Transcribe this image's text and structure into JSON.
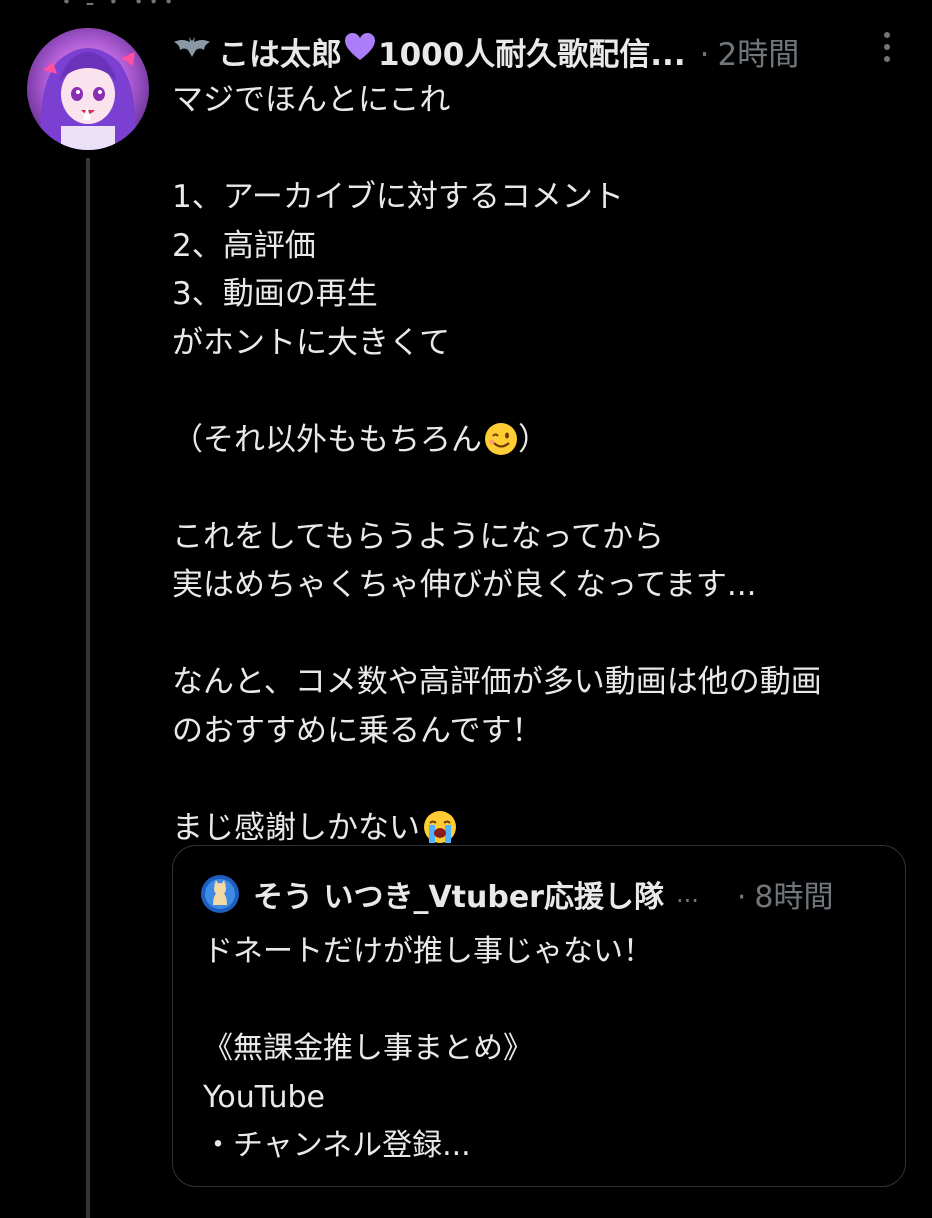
{
  "top_fragment": "･ - ･ ･･･",
  "post": {
    "display_name": "こは太郎",
    "display_name_suffix": "1000人耐久歌配信...",
    "name_emoji_prefix": "bat-emoji",
    "name_emoji_mid": "purple-heart-emoji",
    "separator": "·",
    "time": "2時間",
    "more_icon": "more-vertical-icon",
    "lines": [
      "マジでほんとにこれ",
      "",
      "1、アーカイブに対するコメント",
      "2、高評価",
      "3、動画の再生",
      "がホントに大きくて",
      "",
      "（それ以外ももちろん",
      "",
      "これをしてもらうようになってから",
      "実はめちゃくちゃ伸びが良くなってます...",
      "",
      "なんと、コメ数や高評価が多い動画は他の動画",
      "のおすすめに乗るんです！",
      "",
      "まじ感謝しかない"
    ],
    "wink_line_tail": "）",
    "wink_emoji": "winking-face-emoji",
    "crying_emoji": "loudly-crying-face-emoji"
  },
  "quote": {
    "display_name": "そう いつき_Vtuber応援し隊",
    "ellipsis": "...",
    "separator": "·",
    "time": "8時間",
    "lines": [
      "ドネートだけが推し事じゃない！",
      "",
      "《無課金推し事まとめ》",
      "YouTube",
      "・チャンネル登録..."
    ]
  },
  "colors": {
    "background": "#000000",
    "text_primary": "#e7e9ea",
    "text_secondary": "#71767b",
    "border": "#2f3336",
    "thread_line": "#333639"
  }
}
